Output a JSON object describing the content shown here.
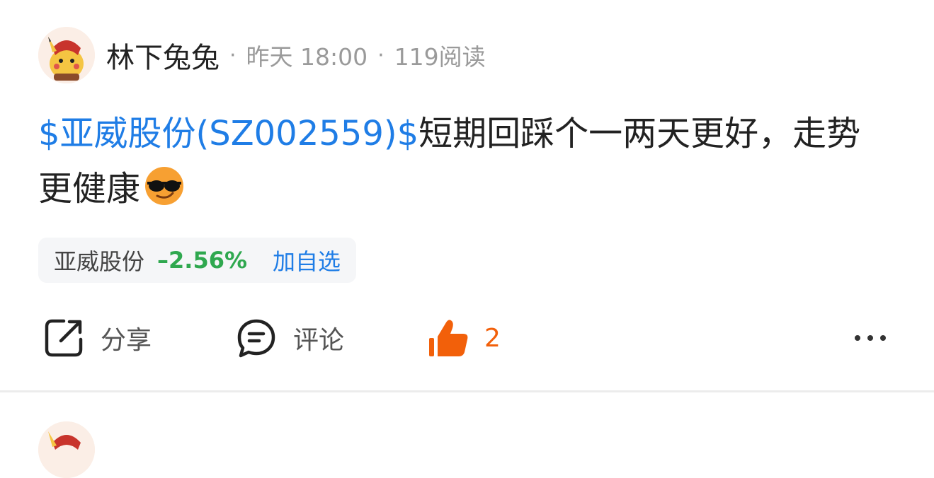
{
  "post": {
    "author": "林下兔兔",
    "time": "昨天 18:00",
    "reads": "119阅读",
    "separator": "·",
    "content": {
      "stock_link": "$亚威股份(SZ002559)$",
      "text": "短期回踩个一两天更好，走势更健康"
    },
    "stock_chip": {
      "name": "亚威股份",
      "change": "–2.56%",
      "add_label": "加自选"
    },
    "actions": {
      "share_label": "分享",
      "comment_label": "评论",
      "like_count": "2"
    }
  },
  "colors": {
    "link": "#1f7de6",
    "down": "#2fa84f",
    "like": "#f2600a",
    "meta": "#9a9a9a"
  },
  "icons": {
    "avatar": "pikachu-avatar",
    "share": "share-icon",
    "comment": "comment-icon",
    "like": "thumbs-up-icon",
    "more": "more-dots-icon",
    "emoji": "sunglasses-emoji"
  }
}
